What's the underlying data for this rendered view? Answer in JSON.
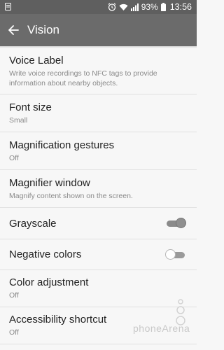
{
  "status_bar": {
    "icons": [
      "notification-icon",
      "alarm-icon",
      "wifi-icon",
      "signal-icon",
      "battery-icon"
    ],
    "battery": "93%",
    "time": "13:56"
  },
  "action_bar": {
    "title": "Vision"
  },
  "items": [
    {
      "label": "Voice Label",
      "sub": "Write voice recordings to NFC tags to provide information about nearby objects."
    },
    {
      "label": "Font size",
      "sub": "Small"
    },
    {
      "label": "Magnification gestures",
      "sub": "Off"
    },
    {
      "label": "Magnifier window",
      "sub": "Magnify content shown on the screen."
    },
    {
      "label": "Grayscale",
      "toggle": "on"
    },
    {
      "label": "Negative colors",
      "toggle": "off"
    },
    {
      "label": "Color adjustment",
      "sub": "Off"
    },
    {
      "label": "Accessibility shortcut",
      "sub": "Off"
    }
  ],
  "watermark": "phoneArena",
  "colors": {
    "status_bar": "#5f5f5f",
    "action_bar": "#6b6b6b",
    "background": "#f7f7f7"
  }
}
